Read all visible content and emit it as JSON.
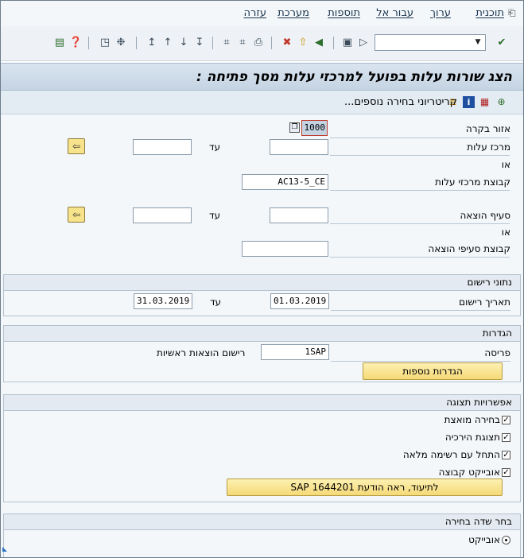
{
  "menu": {
    "items": [
      {
        "label": "תוכנית",
        "icon": "program-menu"
      },
      {
        "label": "ערוך",
        "icon": "edit-menu"
      },
      {
        "label": "עבור אל",
        "icon": "goto-menu"
      },
      {
        "label": "תוספות",
        "icon": "extras-menu"
      },
      {
        "label": "מערכת",
        "icon": "system-menu"
      },
      {
        "label": "עזרה",
        "icon": "help-menu"
      }
    ]
  },
  "toolbar": {
    "command_field_value": ""
  },
  "title": "הצג שורות עלות בפועל למרכזי עלות מסך פתיחה :",
  "app_toolbar": {
    "more_criteria_label": "קריטריוני בחירה נוספים..."
  },
  "selection": {
    "controlling_area_label": "אזור בקרה",
    "controlling_area_value": "1000",
    "cost_center_label": "מרכז עלות",
    "cost_center_from": "",
    "cost_center_to": "",
    "to_label": "עד",
    "or_label": "או",
    "cost_center_group_label": "קבוצת מרכזי עלות",
    "cost_center_group_value": "AC13-5_CE",
    "cost_element_label": "סעיף הוצאה",
    "cost_element_from": "",
    "cost_element_to": "",
    "cost_element_group_label": "קבוצת סעיפי הוצאה",
    "cost_element_group_value": ""
  },
  "posting": {
    "header": "נתוני רישום",
    "posting_date_label": "תאריך רישום",
    "posting_date_from": "01.03.2019",
    "to_label": "עד",
    "posting_date_to": "31.03.2019"
  },
  "settings": {
    "header": "הגדרות",
    "layout_label": "פריסה",
    "layout_value": "1SAP",
    "main_records_label": "רישום הוצאות ראשיות",
    "more_settings_button": "הגדרות נוספות"
  },
  "display_options": {
    "header": "אפשרויות תצוגה",
    "checkboxes": [
      {
        "label": "בחירה מואצת",
        "checked": true
      },
      {
        "label": "תצוגת הירכיה",
        "checked": true
      },
      {
        "label": "התחל עם רשימה מלאה",
        "checked": true
      },
      {
        "label": "אובייקט קבוצה",
        "checked": true
      }
    ],
    "note_button": "לתיעוד, ראה הודעת SAP 1644201"
  },
  "selection_field": {
    "header": "בחר שדה בחירה",
    "radio_label": "אובייקט",
    "radio_selected": true
  }
}
